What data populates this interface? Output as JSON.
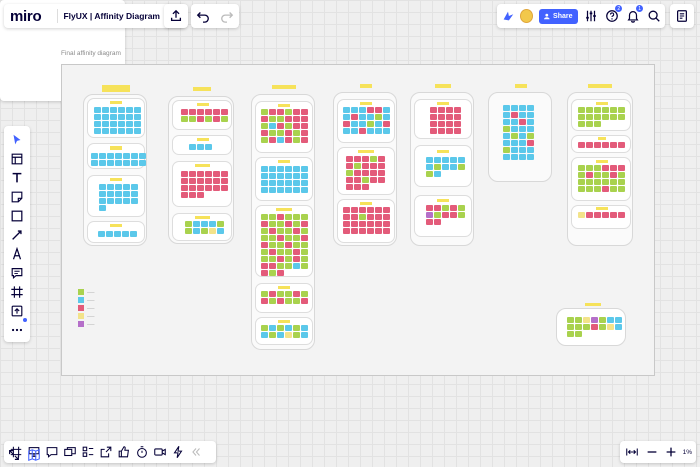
{
  "app": {
    "logo": "miro",
    "board_title": "FlyUX | Affinity Diagram"
  },
  "header": {
    "share_label": "Share",
    "help_badge": "2",
    "notif_badge": "1"
  },
  "canvas": {
    "frame_title": "Final affinity diagram"
  },
  "zoom": {
    "value": "1%"
  },
  "left_toolbar": [
    "select-tool",
    "templates-tool",
    "text-tool",
    "sticky-note-tool",
    "shape-tool",
    "connection-line-tool",
    "pen-tool",
    "comment-tool",
    "frame-tool",
    "upload-tool",
    "more-tools"
  ],
  "bottom_toolbar": [
    "frames-icon",
    "presentation-icon",
    "comment-panel-icon",
    "cards-icon",
    "kanban-icon",
    "reactions-icon",
    "share-screen-icon",
    "timer-icon",
    "video-icon",
    "apps-icon",
    "collapse-icon"
  ],
  "colors": {
    "accent": "#4262ff",
    "sticky_blue": "#5bc8ea",
    "sticky_red": "#e35b7a",
    "sticky_green": "#a9d24e",
    "sticky_yellow": "#f3e38a",
    "sticky_purple": "#b56fc9",
    "header_yellow": "#f6e25a"
  }
}
